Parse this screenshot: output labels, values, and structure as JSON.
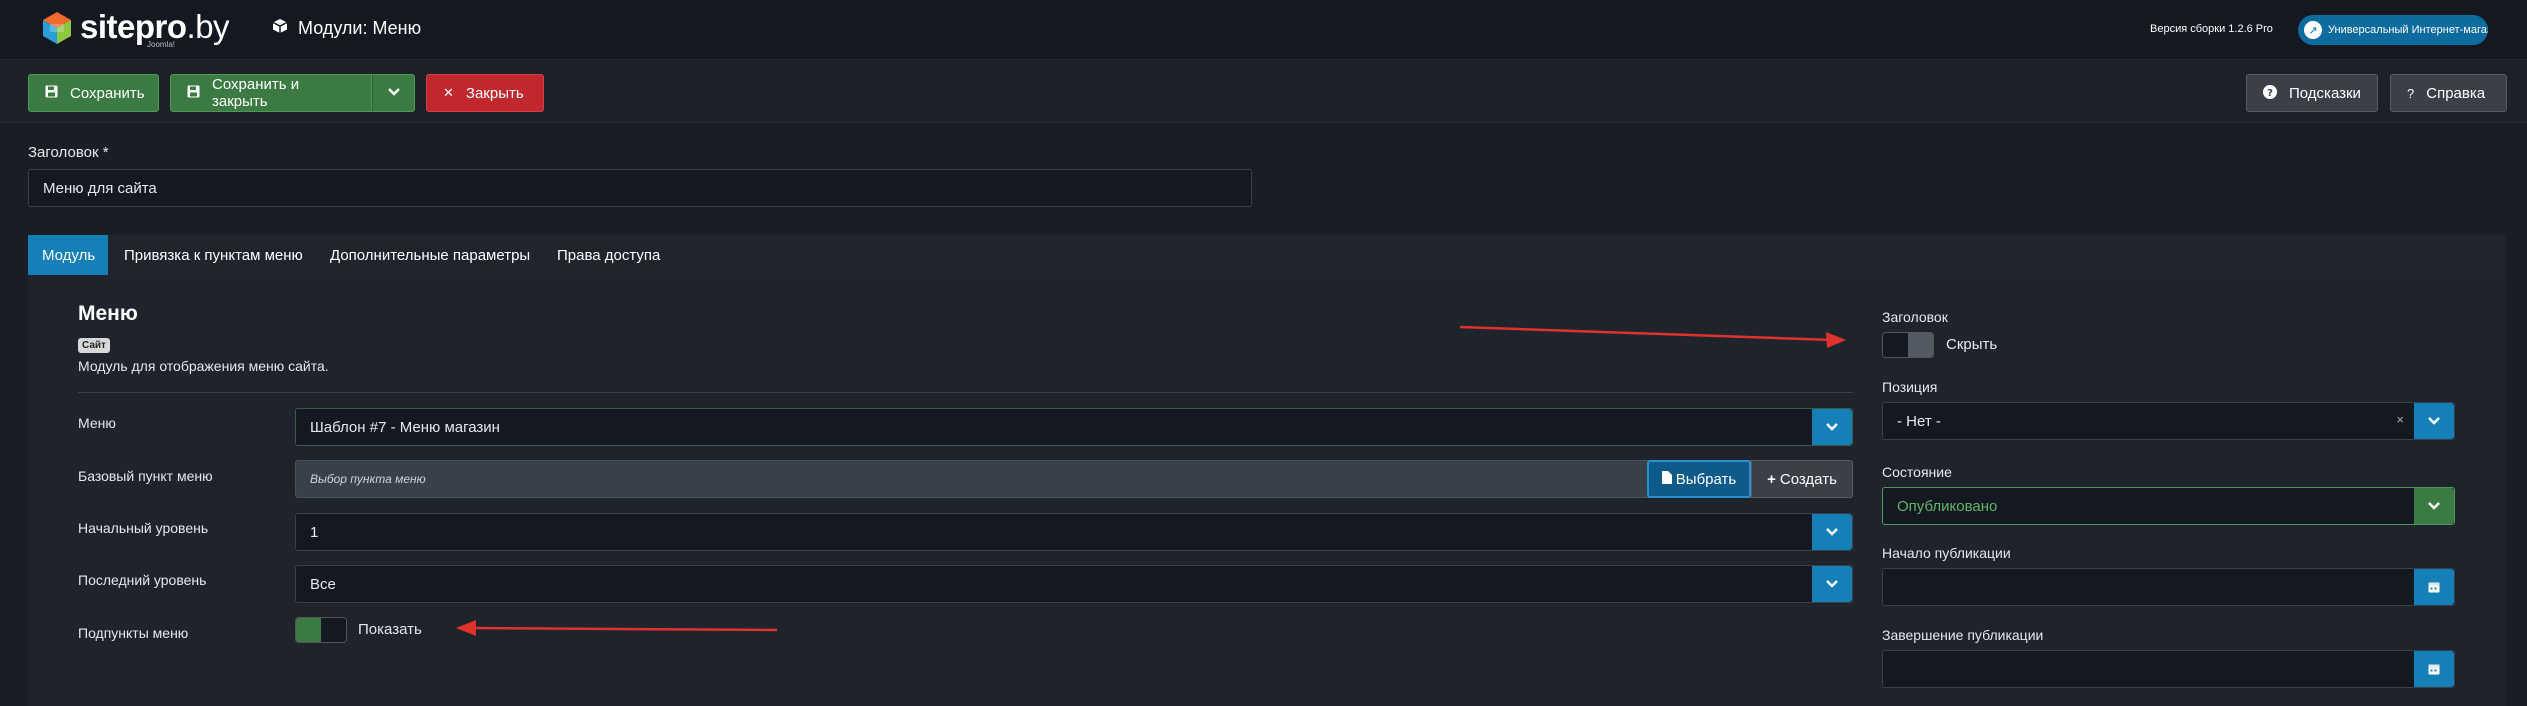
{
  "header": {
    "logo_text": "sitepro",
    "logo_domain": ".by",
    "logo_sub": "Joomla!",
    "page_title": "Модули: Меню",
    "version": "Версия сборки 1.2.6 Pro",
    "site_link": "Универсальный Интернет-магаз..."
  },
  "toolbar": {
    "save": "Сохранить",
    "save_close": "Сохранить и закрыть",
    "close": "Закрыть",
    "hints": "Подсказки",
    "help": "Справка"
  },
  "title_field": {
    "label": "Заголовок *",
    "value": "Меню для сайта"
  },
  "tabs": [
    "Модуль",
    "Привязка к пунктам меню",
    "Дополнительные параметры",
    "Права доступа"
  ],
  "module": {
    "heading": "Меню",
    "badge": "Сайт",
    "description": "Модуль для отображения меню сайта."
  },
  "fields": {
    "menu_label": "Меню",
    "menu_value": "Шаблон #7 - Меню магазин",
    "base_label": "Базовый пункт меню",
    "base_placeholder": "Выбор пункта меню",
    "select_btn": "Выбрать",
    "create_btn": "Создать",
    "start_label": "Начальный уровень",
    "start_value": "1",
    "end_label": "Последний уровень",
    "end_value": "Все",
    "sub_label": "Подпункты меню",
    "sub_value": "Показать"
  },
  "sidebar": {
    "title_label": "Заголовок",
    "title_toggle": "Скрыть",
    "position_label": "Позиция",
    "position_value": "- Нет -",
    "state_label": "Состояние",
    "state_value": "Опубликовано",
    "pub_start_label": "Начало публикации",
    "pub_end_label": "Завершение публикации"
  },
  "colors": {
    "accent": "#1580b8",
    "success": "#3c7a43",
    "danger": "#c0282d",
    "annotation_arrow": "#e0322c"
  }
}
